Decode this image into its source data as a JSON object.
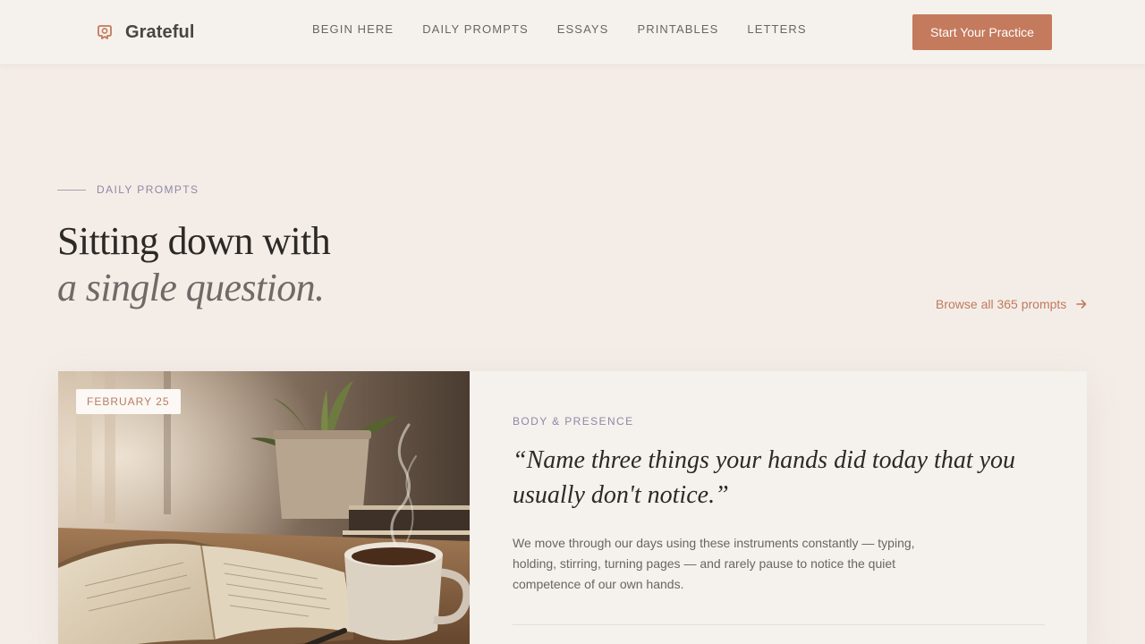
{
  "header": {
    "brand": {
      "name": "Grateful",
      "icon": "grateful-logo-icon",
      "icon_color": "#c47a5d"
    },
    "nav": [
      {
        "label": "BEGIN HERE"
      },
      {
        "label": "DAILY PROMPTS"
      },
      {
        "label": "ESSAYS"
      },
      {
        "label": "PRINTABLES"
      },
      {
        "label": "LETTERS"
      }
    ],
    "cta_label": "Start Your Practice",
    "cta_color": "#c47a5d"
  },
  "section": {
    "eyebrow": "DAILY PROMPTS",
    "headline_line1": "Sitting down with",
    "headline_line2": "a single question.",
    "browse_link": "Browse all 365 prompts",
    "browse_icon": "arrow-right-icon",
    "accent_color": "#bf7a5e"
  },
  "featured_prompt": {
    "date": "FEBRUARY 25",
    "category": "BODY & PRESENCE",
    "quote": "“Name three things your hands did today that you usually don't notice.”",
    "body": "We move through our days using these instruments constantly — typing, holding, stirring, turning pages — and rarely pause to notice the quiet competence of our own hands.",
    "image": "journal-and-coffee-photo"
  }
}
